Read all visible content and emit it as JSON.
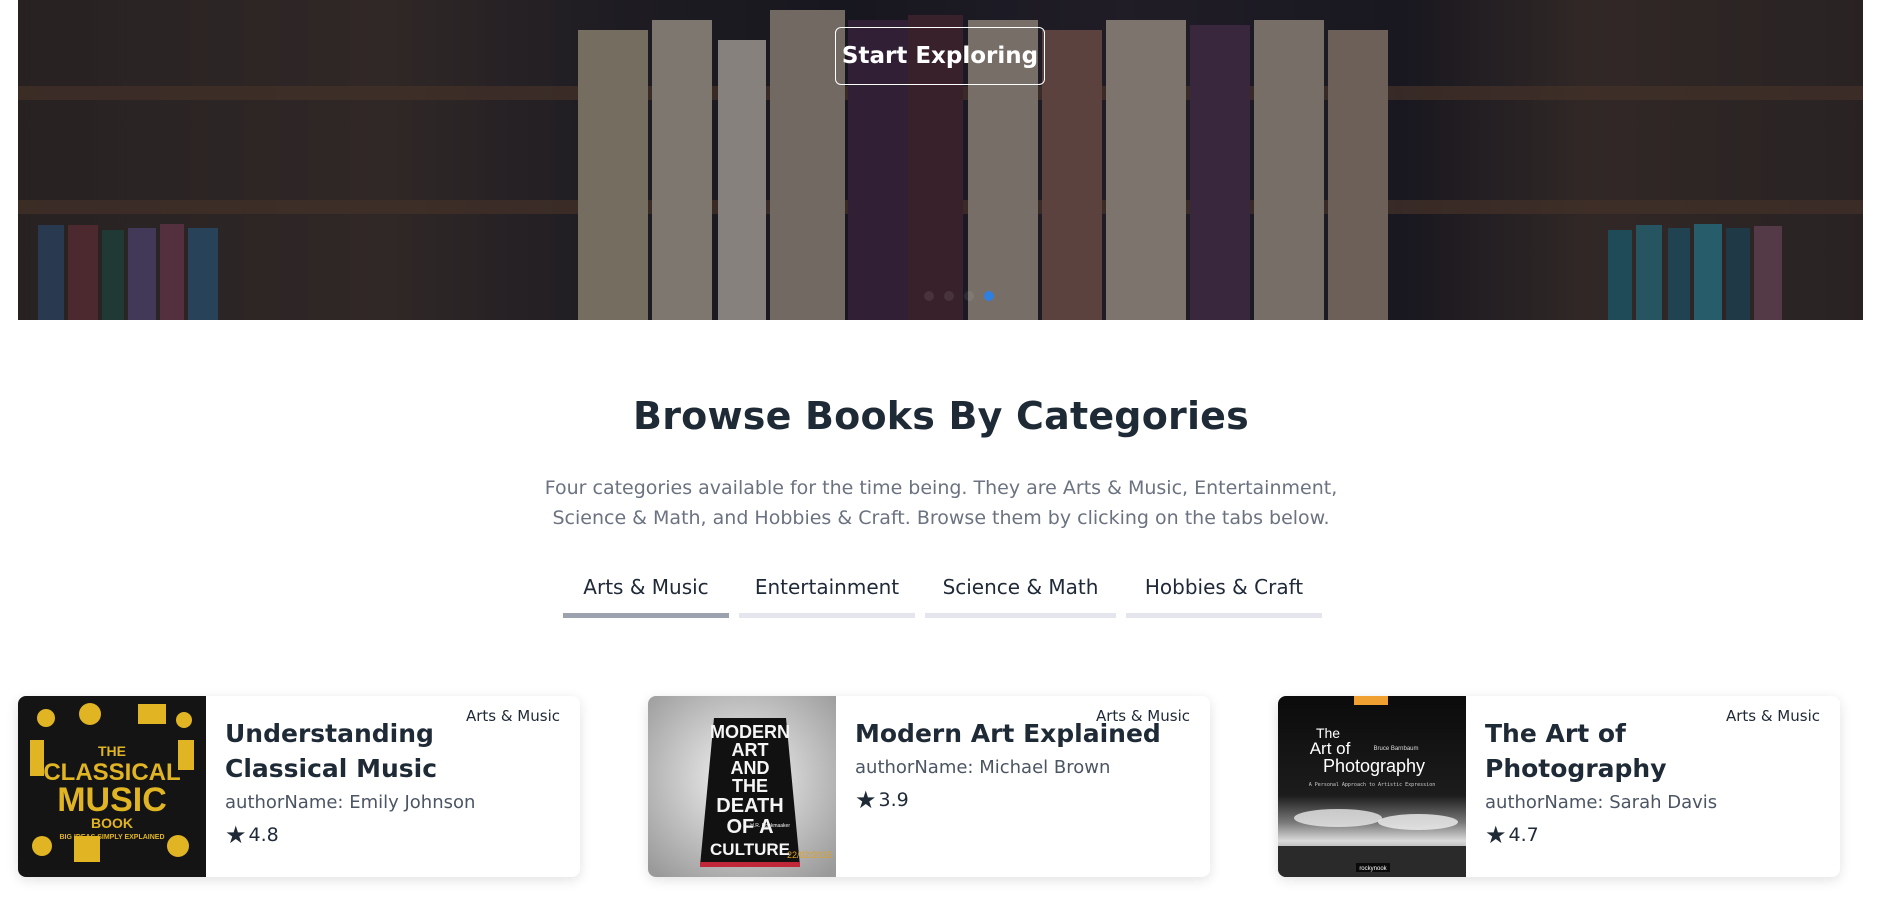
{
  "hero": {
    "cta_label": "Start Exploring",
    "carousel": {
      "slide_count": 4,
      "active_index": 3
    }
  },
  "section": {
    "title": "Browse Books By Categories",
    "description": "Four categories available for the time being. They are Arts & Music, Entertainment, Science & Math, and Hobbies & Craft. Browse them by clicking on the tabs below."
  },
  "tabs": [
    {
      "label": "Arts & Music",
      "active": true
    },
    {
      "label": "Entertainment",
      "active": false
    },
    {
      "label": "Science & Math",
      "active": false
    },
    {
      "label": "Hobbies & Craft",
      "active": false
    }
  ],
  "books": [
    {
      "category": "Arts & Music",
      "title": "Understanding Classical Music",
      "author": "authorName: Emily Johnson",
      "rating": "4.8"
    },
    {
      "category": "Arts & Music",
      "title": "Modern Art Explained",
      "author": "authorName: Michael Brown",
      "rating": "3.9"
    },
    {
      "category": "Arts & Music",
      "title": "The Art of Photography",
      "author": "authorName: Sarah Davis",
      "rating": "4.7"
    }
  ],
  "covers": {
    "classical": {
      "big_words": [
        "THE",
        "CLASSICAL",
        "MUSIC",
        "BOOK"
      ],
      "tagline": "BIG IDEAS SIMPLY EXPLAINED"
    },
    "modern_art": {
      "lines": [
        "MODERN",
        "ART",
        "AND",
        "THE",
        "DEATH",
        "OF A",
        "CULTURE"
      ],
      "author": "H.R. Rookmaaker",
      "date": "22/02/2015"
    },
    "photography": {
      "lines": [
        "The",
        "Art of",
        "Photography"
      ],
      "author": "Bruce Barnbaum",
      "subtitle": "A Personal Approach to Artistic Expression",
      "publisher": "rockynook"
    }
  },
  "icons": {
    "rating": "star-icon"
  },
  "colors": {
    "active_dot": "#2f7fe0",
    "tab_inactive": "#e5e5ee",
    "tab_active": "#9ca3af",
    "cover_gold": "#e0b422"
  }
}
